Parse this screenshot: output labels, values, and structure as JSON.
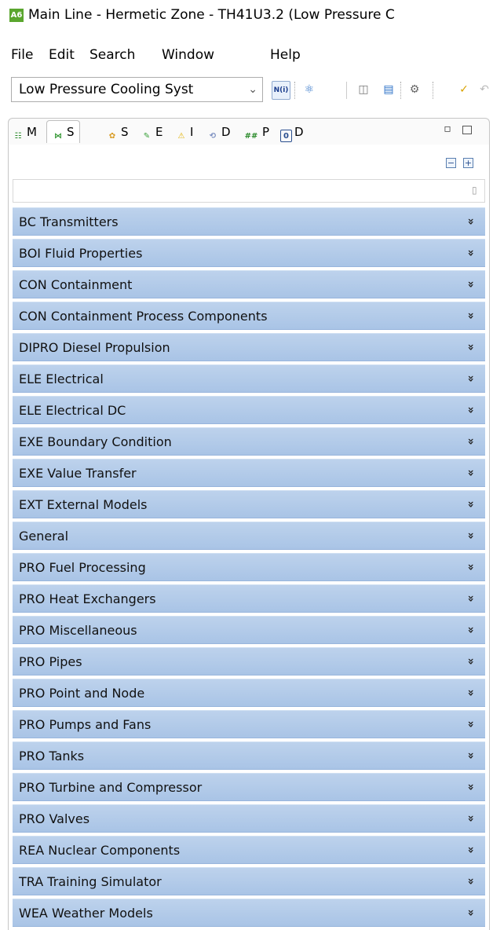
{
  "window": {
    "icon_text": "A6",
    "title": "Main Line - Hermetic Zone - TH41U3.2 (Low Pressure C"
  },
  "menu": [
    "File",
    "Edit",
    "Search",
    "Window",
    "Help"
  ],
  "toolbar": {
    "system_combo_value": "Low Pressure Cooling Syst",
    "n_button_label": "N(i)"
  },
  "tabs": [
    {
      "label": "M",
      "icon": "tree-icon"
    },
    {
      "label": "S",
      "icon": "palette-icon",
      "active": true
    },
    {
      "label": "S",
      "icon": "settings-icon"
    },
    {
      "label": "E",
      "icon": "edit-icon"
    },
    {
      "label": "I",
      "icon": "warning-icon"
    },
    {
      "label": "D",
      "icon": "wrench-icon"
    },
    {
      "label": "P",
      "icon": "hash-icon"
    },
    {
      "label": "D",
      "icon": "clip-icon"
    }
  ],
  "palette": {
    "filter_value": "",
    "items": [
      "BC Transmitters",
      "BOI Fluid Properties",
      "CON Containment",
      "CON Containment Process Components",
      "DIPRO Diesel Propulsion",
      "ELE Electrical",
      "ELE Electrical DC",
      "EXE Boundary Condition",
      "EXE Value Transfer",
      "EXT External Models",
      "General",
      "PRO Fuel Processing",
      "PRO Heat Exchangers",
      "PRO Miscellaneous",
      "PRO Pipes",
      "PRO Point and Node",
      "PRO Pumps and Fans",
      "PRO Tanks",
      "PRO Turbine and Compressor",
      "PRO Valves",
      "REA Nuclear Components",
      "TRA Training Simulator",
      "WEA Weather Models"
    ]
  },
  "colors": {
    "row_background": "#b3cbe9",
    "app_icon": "#5aa62e"
  }
}
